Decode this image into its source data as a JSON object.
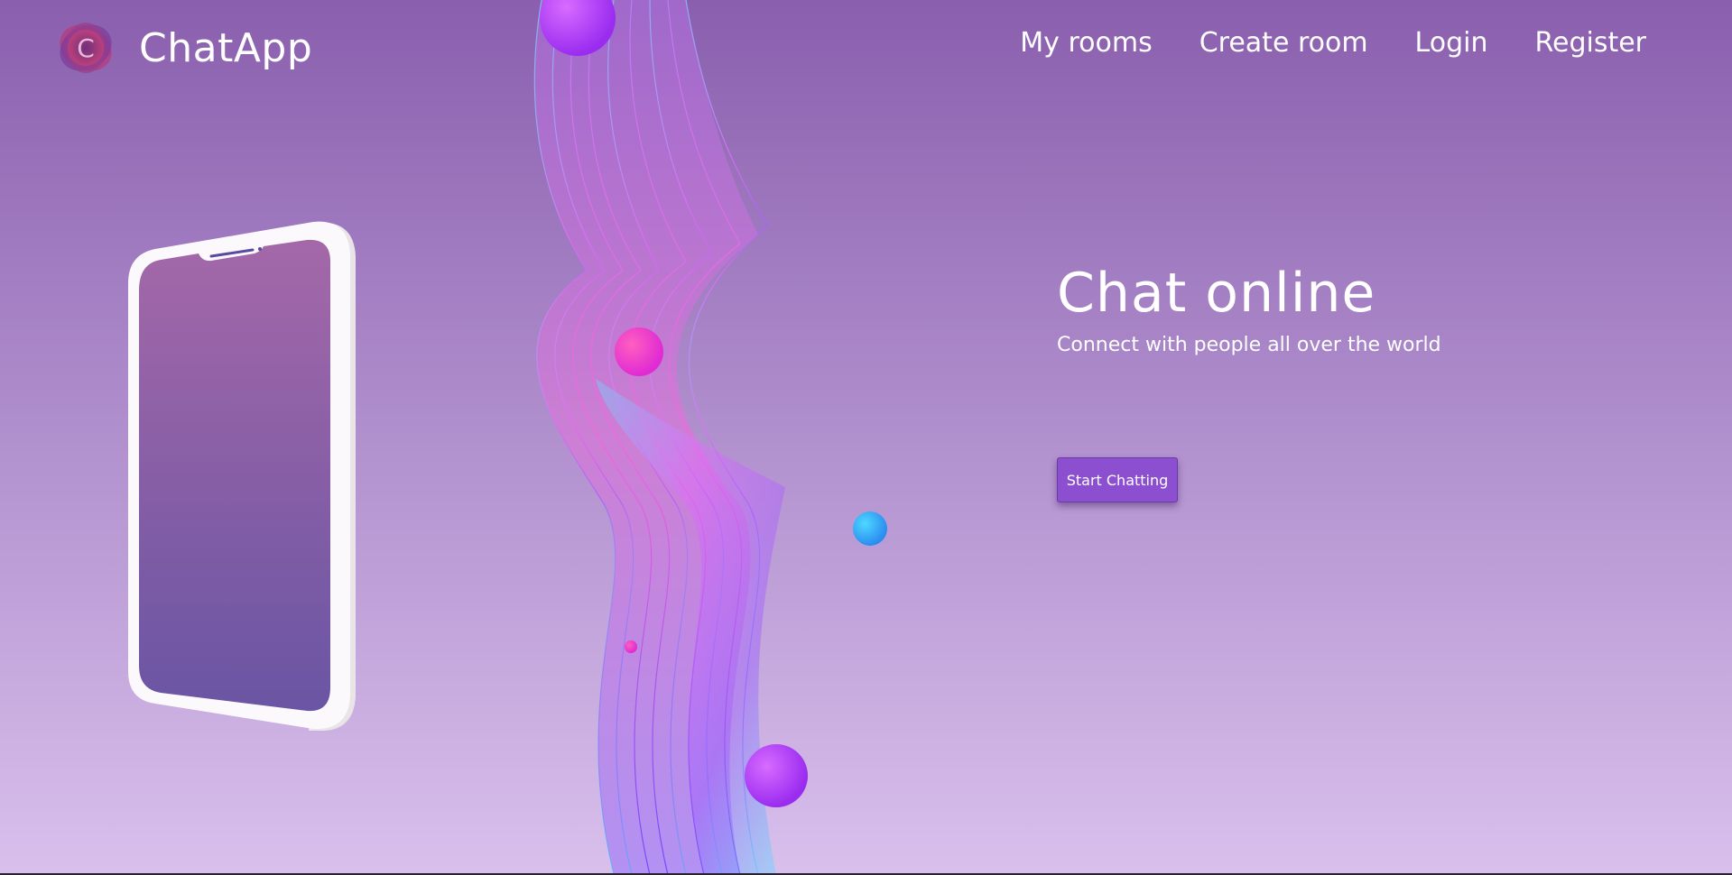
{
  "app": {
    "name": "ChatApp",
    "logo_letter": "C"
  },
  "nav": {
    "items": [
      {
        "label": "My rooms"
      },
      {
        "label": "Create room"
      },
      {
        "label": "Login"
      },
      {
        "label": "Register"
      }
    ]
  },
  "hero": {
    "title": "Chat online",
    "subtitle": "Connect with people all over the world",
    "cta_label": "Start Chatting"
  },
  "colors": {
    "background_top": "#8a5fae",
    "background_bottom": "#d9c0ec",
    "button": "#8c4fd0",
    "text": "#ffffff"
  },
  "icons": {
    "logo": "chatapp-logo-icon"
  }
}
